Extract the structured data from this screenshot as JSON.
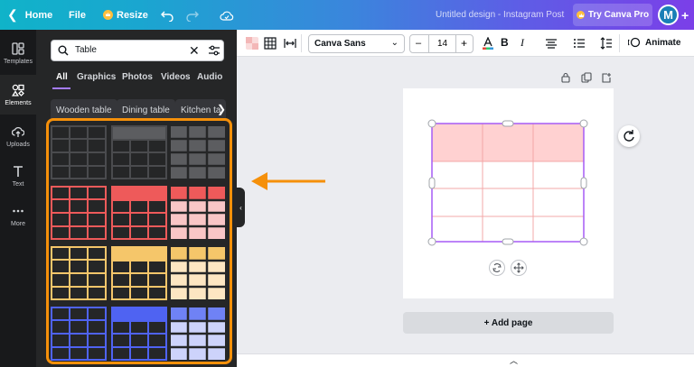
{
  "topbar": {
    "home_label": "Home",
    "file_label": "File",
    "resize_label": "Resize",
    "title": "Untitled design - Instagram Post",
    "try_pro_label": "Try Canva Pro",
    "avatar_initial": "M"
  },
  "rail": {
    "items": [
      {
        "label": "Templates",
        "icon": "templates-icon"
      },
      {
        "label": "Elements",
        "icon": "elements-icon"
      },
      {
        "label": "Uploads",
        "icon": "upload-icon"
      },
      {
        "label": "Text",
        "icon": "text-icon"
      },
      {
        "label": "More",
        "icon": "more-icon"
      }
    ]
  },
  "panel": {
    "search_value": "Table",
    "tabs": [
      "All",
      "Graphics",
      "Photos",
      "Videos",
      "Audio"
    ],
    "chips": [
      "Wooden table",
      "Dining table",
      "Kitchen ta"
    ]
  },
  "toolbar": {
    "font_name": "Canva Sans",
    "font_size": "14",
    "animate_label": "Animate"
  },
  "canvas": {
    "add_page_label": "+ Add page"
  },
  "colors": {
    "accent_purple": "#8b3dff",
    "highlight_orange": "#f5900a",
    "table_dark": "#3a3b3e",
    "table_red": "#ee5a5a",
    "table_yellow": "#f5c66a",
    "table_blue": "#4f63f2",
    "selected_table_header": "#ffd1d1"
  }
}
